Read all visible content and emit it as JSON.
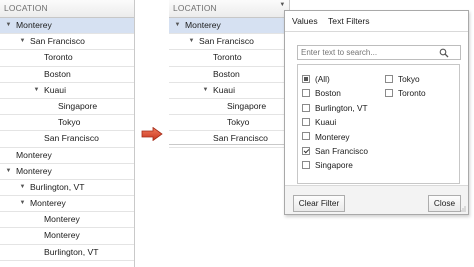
{
  "grid_left": {
    "header": "LOCATION",
    "rows": [
      {
        "label": "Monterey",
        "level": 0,
        "toggle": "▼",
        "selected": true
      },
      {
        "label": "San Francisco",
        "level": 1,
        "toggle": "▼",
        "selected": false
      },
      {
        "label": "Toronto",
        "level": 2,
        "toggle": "",
        "selected": false
      },
      {
        "label": "Boston",
        "level": 2,
        "toggle": "",
        "selected": false
      },
      {
        "label": "Kuaui",
        "level": 2,
        "toggle": "▼",
        "selected": false
      },
      {
        "label": "Singapore",
        "level": 3,
        "toggle": "",
        "selected": false
      },
      {
        "label": "Tokyo",
        "level": 3,
        "toggle": "",
        "selected": false
      },
      {
        "label": "San Francisco",
        "level": 2,
        "toggle": "",
        "selected": false
      },
      {
        "label": "Monterey",
        "level": 0,
        "toggle": "",
        "selected": false
      },
      {
        "label": "Monterey",
        "level": 0,
        "toggle": "▼",
        "selected": false
      },
      {
        "label": "Burlington, VT",
        "level": 1,
        "toggle": "▼",
        "selected": false
      },
      {
        "label": "Monterey",
        "level": 1,
        "toggle": "▼",
        "selected": false
      },
      {
        "label": "Monterey",
        "level": 2,
        "toggle": "",
        "selected": false
      },
      {
        "label": "Monterey",
        "level": 2,
        "toggle": "",
        "selected": false
      },
      {
        "label": "Burlington, VT",
        "level": 2,
        "toggle": "",
        "selected": false
      }
    ]
  },
  "grid_right": {
    "header": "LOCATION",
    "filter_icon": "funnel-dropdown-icon",
    "rows": [
      {
        "label": "Monterey",
        "level": 0,
        "toggle": "▼",
        "selected": true
      },
      {
        "label": "San Francisco",
        "level": 1,
        "toggle": "▼",
        "selected": false
      },
      {
        "label": "Toronto",
        "level": 2,
        "toggle": "",
        "selected": false
      },
      {
        "label": "Boston",
        "level": 2,
        "toggle": "",
        "selected": false
      },
      {
        "label": "Kuaui",
        "level": 2,
        "toggle": "▼",
        "selected": false
      },
      {
        "label": "Singapore",
        "level": 3,
        "toggle": "",
        "selected": false
      },
      {
        "label": "Tokyo",
        "level": 3,
        "toggle": "",
        "selected": false
      },
      {
        "label": "San Francisco",
        "level": 2,
        "toggle": "",
        "selected": false
      }
    ]
  },
  "arrow": {
    "icon": "right-arrow-icon",
    "color": "#d9452b"
  },
  "filter_popup": {
    "tabs": {
      "values": "Values",
      "text_filters": "Text Filters"
    },
    "search_placeholder": "Enter text to search...",
    "items": [
      {
        "label": "(All)",
        "state": "indeterminate"
      },
      {
        "label": "Boston",
        "state": "unchecked"
      },
      {
        "label": "Burlington, VT",
        "state": "unchecked"
      },
      {
        "label": "Kuaui",
        "state": "unchecked"
      },
      {
        "label": "Monterey",
        "state": "unchecked"
      },
      {
        "label": "San Francisco",
        "state": "checked"
      },
      {
        "label": "Singapore",
        "state": "unchecked"
      },
      {
        "label": "Tokyo",
        "state": "unchecked"
      },
      {
        "label": "Toronto",
        "state": "unchecked"
      }
    ],
    "buttons": {
      "clear": "Clear Filter",
      "close": "Close"
    }
  },
  "colors": {
    "selected_row": "#d6e1f2",
    "arrow": "#d9452b",
    "header_text": "#6f6f6f"
  }
}
